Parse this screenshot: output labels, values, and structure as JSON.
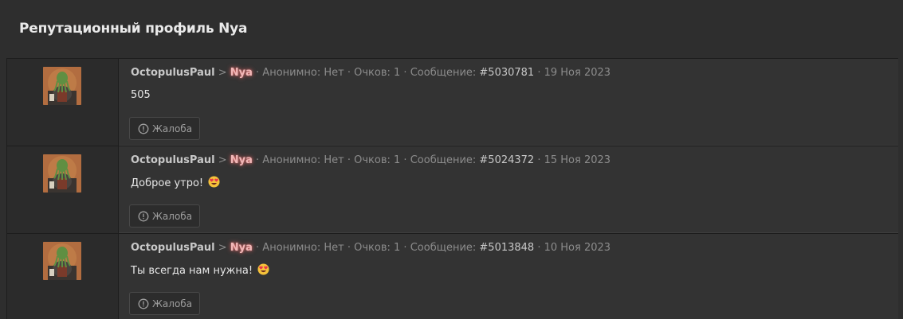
{
  "page": {
    "title": "Репутационный профиль Nya"
  },
  "labels": {
    "separator_user": " > ",
    "dot": " · ",
    "anonymous": "Анонимно: Нет",
    "points": "Очков: 1",
    "message_prefix": "Сообщение: ",
    "report": "Жалоба"
  },
  "colors": {
    "background": "#2e2e2e",
    "target_glow": "#ff6e6e",
    "text_muted": "#8c8c8c"
  },
  "entries": [
    {
      "author": "OctopulusPaul",
      "target": "Nya",
      "post_id": "#5030781",
      "date": "19 Ноя 2023",
      "text": "505",
      "emoji": ""
    },
    {
      "author": "OctopulusPaul",
      "target": "Nya",
      "post_id": "#5024372",
      "date": "15 Ноя 2023",
      "text": "Доброе утро! ",
      "emoji": "heart-eyes-emoji"
    },
    {
      "author": "OctopulusPaul",
      "target": "Nya",
      "post_id": "#5013848",
      "date": "10 Ноя 2023",
      "text": "Ты всегда нам нужна! ",
      "emoji": "heart-eyes-emoji"
    }
  ]
}
